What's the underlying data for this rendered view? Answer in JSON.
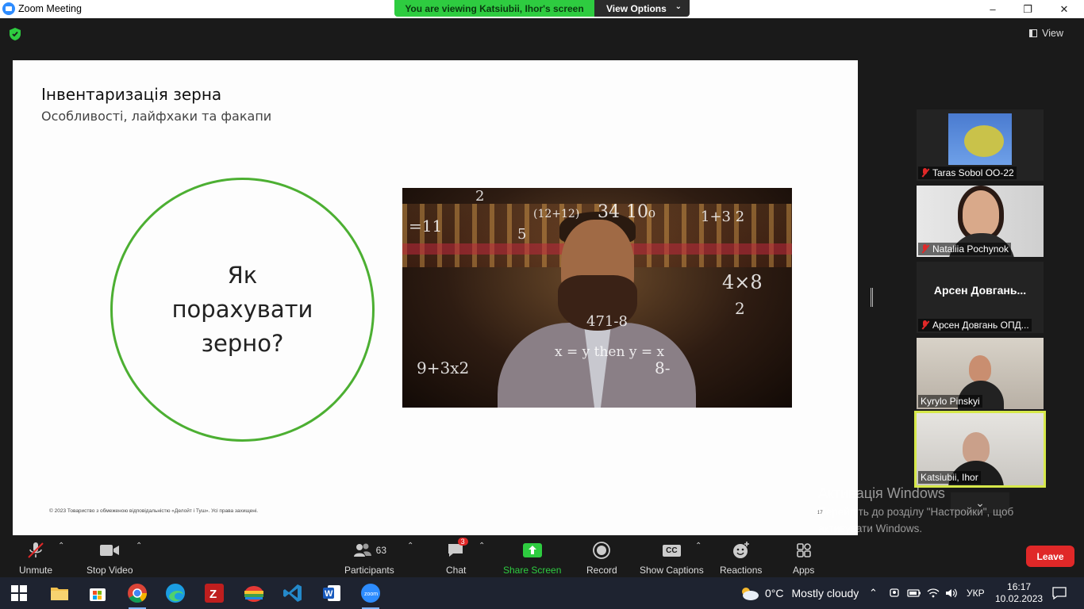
{
  "window": {
    "title": "Zoom Meeting",
    "minimize": "–",
    "maximize": "❐",
    "close": "✕"
  },
  "banner": {
    "viewing": "You are viewing Katsiubii, Ihor's screen",
    "view_options": "View Options"
  },
  "header": {
    "view_label": "View"
  },
  "slide": {
    "title": "Інвентаризація зерна",
    "subtitle": "Особливості, лайфхаки та факапи",
    "question": "Як порахувати зерно?",
    "copyright": "© 2023 Товариство з обмеженою відповідальністю «Делойт і Туш». Усі права захищені.",
    "page": "17",
    "math": [
      "=11",
      "2",
      "(12+12)",
      "34",
      "10₀",
      "1+3 2",
      "5",
      "4×8",
      "2",
      "x = y then y = x",
      "9+3x2",
      "8-",
      "471-8"
    ]
  },
  "participants": [
    {
      "name": "Taras Sobol OO-22",
      "muted": true
    },
    {
      "name": "Nataliia Pochynok",
      "muted": true
    },
    {
      "name": "Арсен Довгань ОПД...",
      "display": "Арсен  Довгань...",
      "muted": true
    },
    {
      "name": "Kyrylo Pinskyi",
      "muted": false
    },
    {
      "name": "Katsiubii, Ihor",
      "muted": false,
      "active": true
    }
  ],
  "watermark": {
    "line1": "Активація Windows",
    "line2": "Перейдіть до розділу \"Настройки\", щоб",
    "line3": "активувати Windows."
  },
  "toolbar": {
    "unmute": "Unmute",
    "stop_video": "Stop Video",
    "participants": "Participants",
    "participants_count": "63",
    "chat": "Chat",
    "chat_badge": "3",
    "share_screen": "Share Screen",
    "record": "Record",
    "show_captions": "Show Captions",
    "captions_icon": "CC",
    "reactions": "Reactions",
    "apps": "Apps",
    "leave": "Leave"
  },
  "taskbar": {
    "weather_temp": "0°C",
    "weather_text": "Mostly cloudy",
    "language": "УКР",
    "time": "16:17",
    "date": "10.02.2023"
  },
  "colors": {
    "zoom_green": "#2ecc40",
    "leave_red": "#e02828",
    "circle_green": "#4caf32",
    "active_tile": "#d6e84a"
  }
}
